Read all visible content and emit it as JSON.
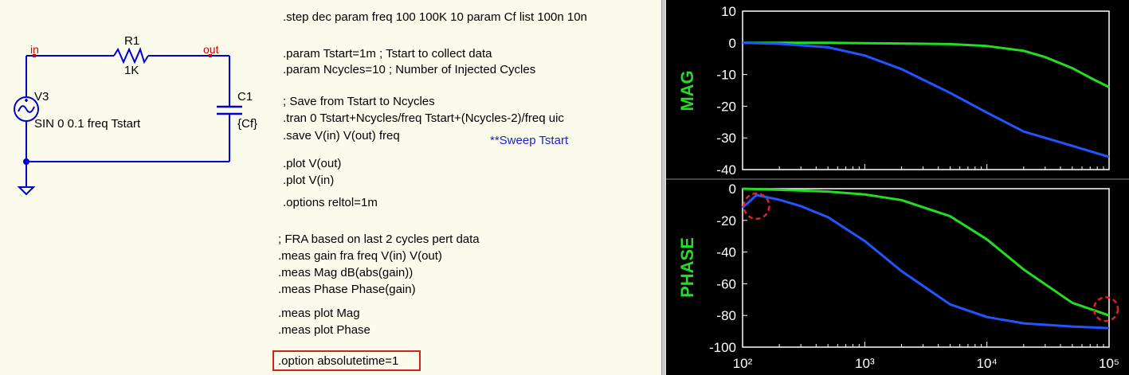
{
  "schematic": {
    "labels": {
      "r1_name": "R1",
      "r1_value": "1K",
      "c1_name": "C1",
      "c1_value": "{Cf}",
      "v3_name": "V3",
      "v3_value": "SIN 0 0.1 freq Tstart",
      "net_in": "in",
      "net_out": "out"
    },
    "directives": [
      ".step dec param freq 100 100K 10 param Cf list 100n 10n",
      ".param Tstart=1m ; Tstart to collect data",
      ".param Ncycles=10 ; Number of Injected Cycles",
      "; Save from Tstart to Ncycles",
      ".tran 0 Tstart+Ncycles/freq Tstart+(Ncycles-2)/freq uic",
      ".save V(in) V(out) freq",
      ".plot V(out)",
      ".plot V(in)",
      ".options reltol=1m",
      "; FRA based on last 2 cycles pert data",
      ".meas gain fra freq V(in) V(out)",
      ".meas Mag dB(abs(gain))",
      ".meas Phase Phase(gain)",
      ".meas plot Mag",
      ".meas plot Phase",
      ".option absolutetime=1"
    ],
    "sweep_comment": "**Sweep Tstart"
  },
  "colors": {
    "background": "#fbfbeb",
    "wire": "#0000d0",
    "net_label": "#d00000",
    "plot_bg": "#000000",
    "trace_green": "#22dd22",
    "trace_blue": "#2255ff",
    "axis_text": "#ffffff",
    "highlight": "#dd2222"
  },
  "chart_data": [
    {
      "type": "line",
      "ylabel": "MAG",
      "xlabel": "",
      "log_x": true,
      "xlim": [
        100,
        100000
      ],
      "ylim": [
        -40,
        10
      ],
      "yticks": [
        "10",
        "0",
        "-10",
        "-20",
        "-30",
        "-40"
      ],
      "series": [
        {
          "color": "#22dd22",
          "x": [
            100,
            200,
            500,
            1000,
            2000,
            5000,
            10000,
            20000,
            30000,
            50000,
            70000,
            100000
          ],
          "y": [
            0,
            0,
            0,
            -0.1,
            -0.2,
            -0.4,
            -1,
            -2.5,
            -4.5,
            -8,
            -11,
            -14
          ]
        },
        {
          "color": "#2255ff",
          "x": [
            100,
            200,
            500,
            1000,
            2000,
            5000,
            10000,
            20000,
            50000,
            100000
          ],
          "y": [
            0,
            -0.3,
            -1.4,
            -4,
            -8.3,
            -15.8,
            -22,
            -28,
            -32.5,
            -36
          ]
        }
      ]
    },
    {
      "type": "line",
      "ylabel": "PHASE",
      "xlabel": "",
      "log_x": true,
      "xlim": [
        100,
        100000
      ],
      "ylim": [
        -100,
        0
      ],
      "xticks": [
        "10²",
        "10³",
        "10⁴",
        "10⁵"
      ],
      "yticks": [
        "0",
        "-20",
        "-40",
        "-60",
        "-80",
        "-100"
      ],
      "series": [
        {
          "color": "#22dd22",
          "x": [
            100,
            200,
            500,
            1000,
            2000,
            5000,
            10000,
            20000,
            50000,
            100000
          ],
          "y": [
            0,
            -0.7,
            -1.8,
            -3.6,
            -7.2,
            -17.4,
            -32,
            -51,
            -72,
            -80
          ]
        },
        {
          "color": "#2255ff",
          "x": [
            100,
            130,
            200,
            300,
            500,
            1000,
            2000,
            5000,
            10000,
            20000,
            50000,
            100000
          ],
          "y": [
            -12,
            -4,
            -7,
            -11,
            -18,
            -33,
            -52,
            -73,
            -81,
            -85,
            -87,
            -88
          ]
        }
      ]
    }
  ]
}
